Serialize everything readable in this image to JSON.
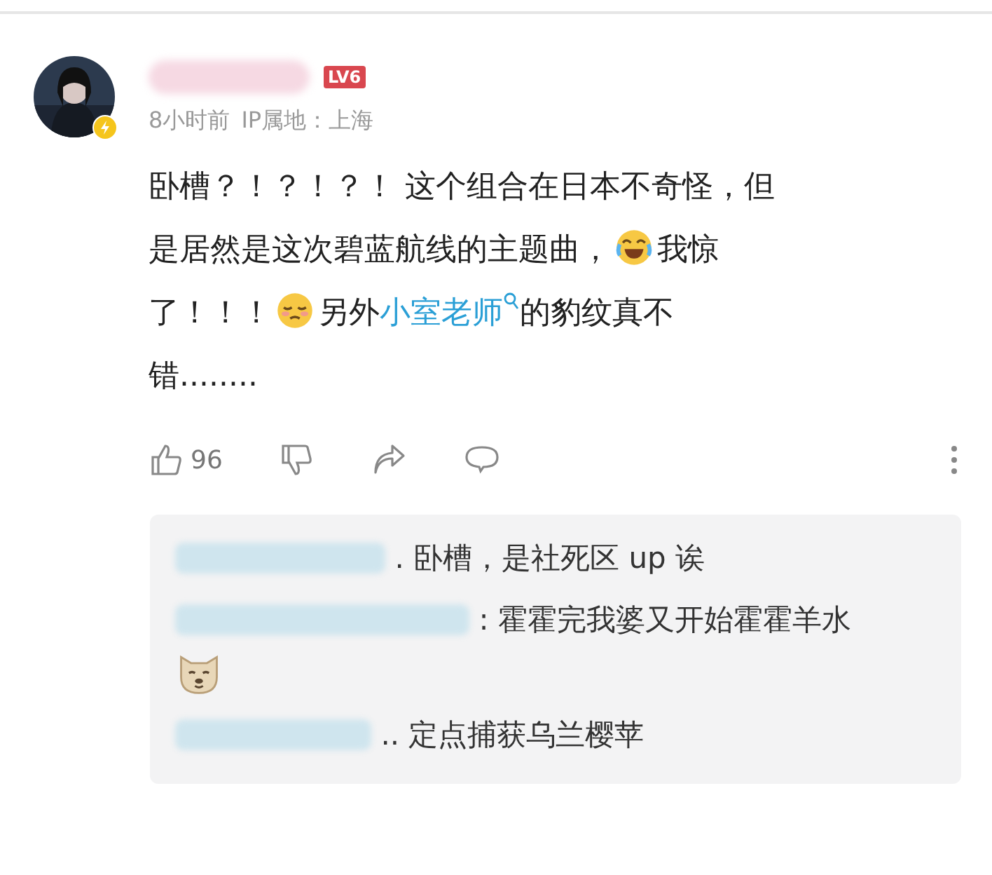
{
  "comment": {
    "level_badge": "LV6",
    "time": "8小时前",
    "ip": "IP属地：上海",
    "lines": [
      [
        {
          "kind": "text",
          "text": "卧槽？！？！？！ 这个组合在日本不奇怪，但"
        }
      ],
      [
        {
          "kind": "text",
          "text": "是居然是这次碧蓝航线的主题曲，"
        },
        {
          "kind": "emoji"
        },
        {
          "kind": "text",
          "text": "我惊"
        }
      ],
      [
        {
          "kind": "text",
          "text": "了！！！"
        },
        {
          "kind": "emoji"
        },
        {
          "kind": "text",
          "text": "另外"
        },
        {
          "kind": "link",
          "text": "小室老师"
        },
        {
          "kind": "text",
          "text": "的豹纹真不"
        }
      ],
      [
        {
          "kind": "text",
          "text": "错........"
        }
      ]
    ],
    "likes": "96"
  },
  "replies": [
    {
      "content": [
        {
          "kind": "text",
          "text": ". 卧槽，是社死区 up 诶"
        }
      ]
    },
    {
      "content": [
        {
          "kind": "text",
          "text": ": 霍霍完我婆又开始霍霍羊水"
        },
        {
          "kind": "emoji"
        }
      ]
    },
    {
      "content": [
        {
          "kind": "text",
          "text": ".. 定点捕获乌兰樱苹"
        }
      ]
    }
  ]
}
